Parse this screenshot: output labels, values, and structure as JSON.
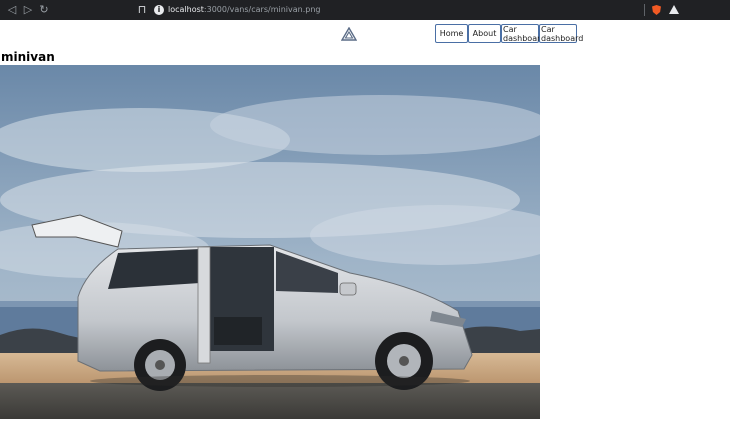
{
  "browser": {
    "url_host": "localhost",
    "url_path": ":3000/vans/cars/minivan.png"
  },
  "header": {
    "nav": [
      {
        "label": "Home"
      },
      {
        "label": "About"
      },
      {
        "label": "Car dashboard"
      },
      {
        "label": "Car dashboard"
      }
    ]
  },
  "page": {
    "title": "minivan"
  },
  "hero": {
    "image_alt": "minivan",
    "van_color": "#c9ccd0",
    "sky_color": "#7c93ad",
    "sea_color": "#5e7897",
    "sand_color": "#c8a782"
  }
}
